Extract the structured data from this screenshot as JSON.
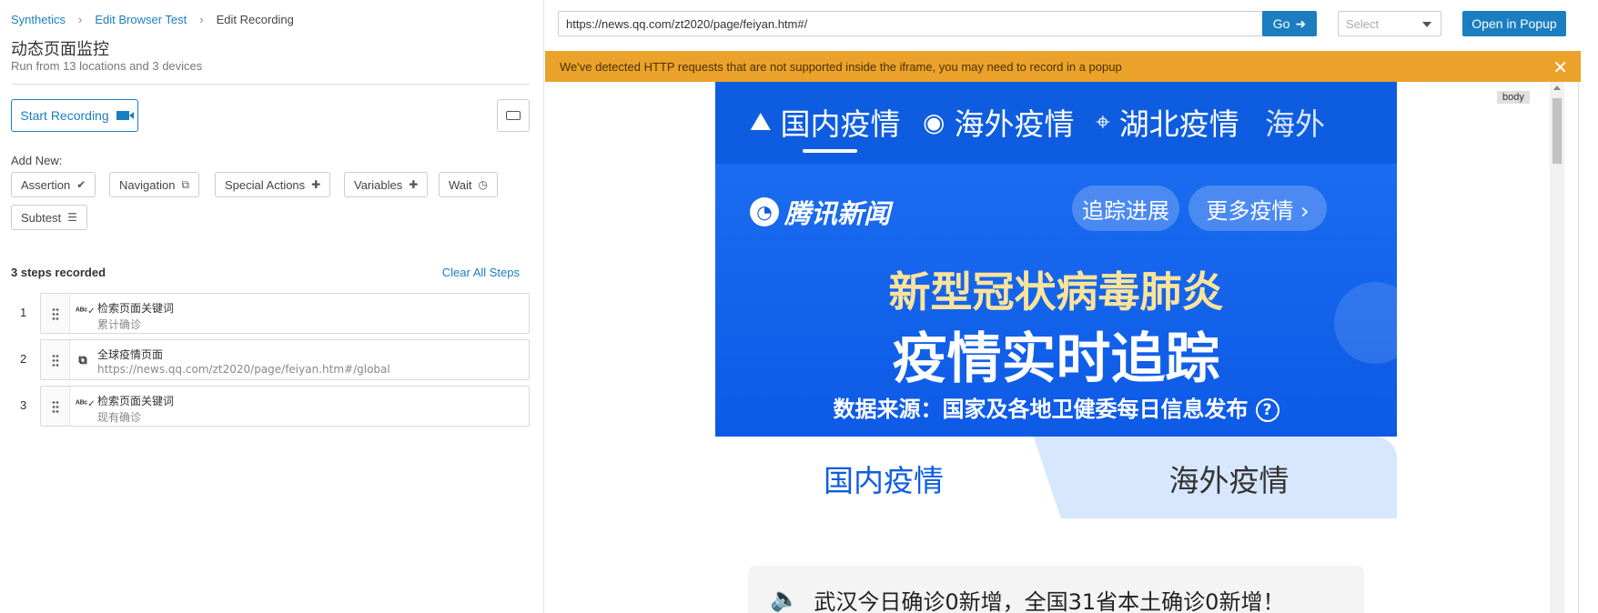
{
  "breadcrumb": {
    "items": [
      "Synthetics",
      "Edit Browser Test"
    ],
    "current": "Edit Recording"
  },
  "header": {
    "title": "动态页面监控",
    "subtitle": "Run from 13 locations and 3 devices"
  },
  "recording": {
    "start_label": "Start Recording"
  },
  "add_new": {
    "label": "Add New:",
    "assertion": "Assertion",
    "navigation": "Navigation",
    "special_actions": "Special Actions",
    "variables": "Variables",
    "wait": "Wait",
    "subtest": "Subtest"
  },
  "steps": {
    "count_label": "3 steps recorded",
    "clear_label": "Clear All Steps",
    "items": [
      {
        "num": "1",
        "icon": "assert-text-icon",
        "title": "检索页面关键词",
        "detail": "累计确诊"
      },
      {
        "num": "2",
        "icon": "external-link-icon",
        "title": "全球疫情页面",
        "detail": "https://news.qq.com/zt2020/page/feiyan.htm#/global"
      },
      {
        "num": "3",
        "icon": "assert-text-icon",
        "title": "检索页面关键词",
        "detail": "现有确诊"
      }
    ]
  },
  "browser": {
    "url": "https://news.qq.com/zt2020/page/feiyan.htm#/",
    "go_label": "Go",
    "select_placeholder": "Select",
    "popup_label": "Open in Popup",
    "warning": "We've detected HTTP requests that are not supported inside the iframe, you may need to record in a popup",
    "element_tag": "body"
  },
  "site": {
    "nav": [
      "国内疫情",
      "海外疫情",
      "湖北疫情",
      "海外"
    ],
    "logo": "腾讯新闻",
    "pill_track": "追踪进展",
    "pill_more": "更多疫情 ›",
    "hero_line1": "新型冠状病毒肺炎",
    "hero_line2": "疫情实时追踪",
    "hero_source": "数据来源：国家及各地卫健委每日信息发布",
    "tab_domestic": "国内疫情",
    "tab_overseas": "海外疫情",
    "notice": "武汉今日确诊0新增，全国31省本土确诊0新增！"
  },
  "colors": {
    "accent": "#1a7ec1",
    "warning": "#eaa22a",
    "site_blue": "#0e5de0",
    "hero_gold": "#fde49b"
  }
}
